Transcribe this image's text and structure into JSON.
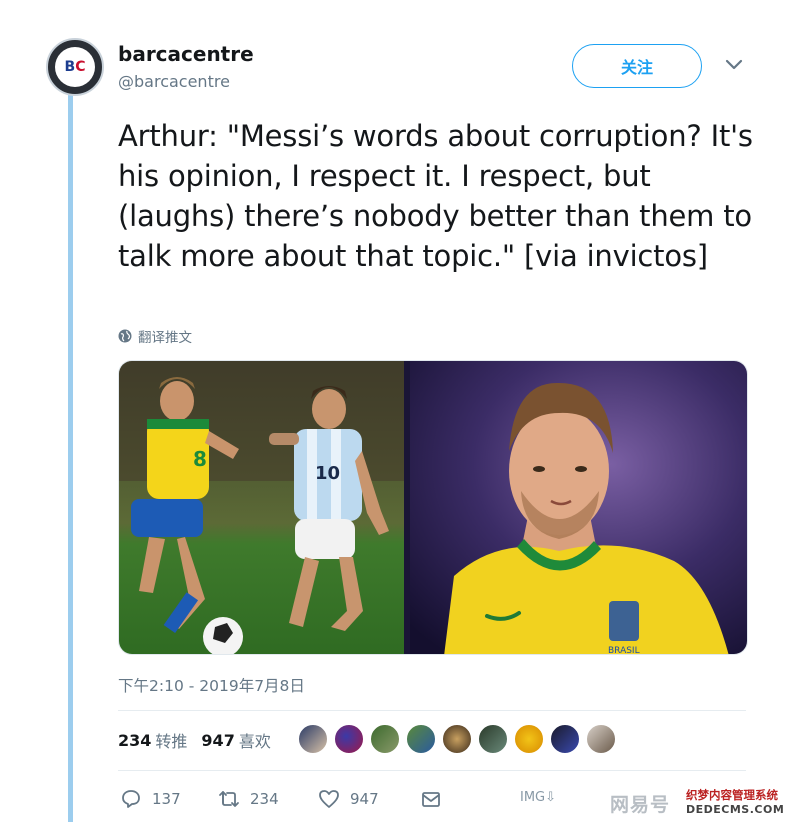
{
  "account": {
    "display_name": "barcacentre",
    "handle": "@barcacentre",
    "avatar_text": "BC"
  },
  "follow_button": "关注",
  "tweet": {
    "text": "Arthur: \"Messi’s words about corruption? It's his opinion, I respect it.  I respect, but (laughs) there’s nobody better than them to talk more about that topic.\" [via invictos]",
    "translate_label": "翻译推文",
    "timestamp": "下午2:10 - 2019年7月8日"
  },
  "media": {
    "left_shirt_number": "8",
    "right_badge_text": "BRASIL"
  },
  "stats": {
    "retweets_count": "234",
    "retweets_label": "转推",
    "likes_count": "947",
    "likes_label": "喜欢"
  },
  "actions": {
    "reply_count": "137",
    "retweet_count": "234",
    "like_count": "947",
    "image_badge": "IMG⇩"
  },
  "watermarks": {
    "netease": "网易号",
    "dede_top": "织梦内容管理系统",
    "dede_bottom": "DEDECMS.COM"
  },
  "colors": {
    "accent": "#1da1f2",
    "muted": "#657786",
    "thread_line": "#9ccdee"
  }
}
